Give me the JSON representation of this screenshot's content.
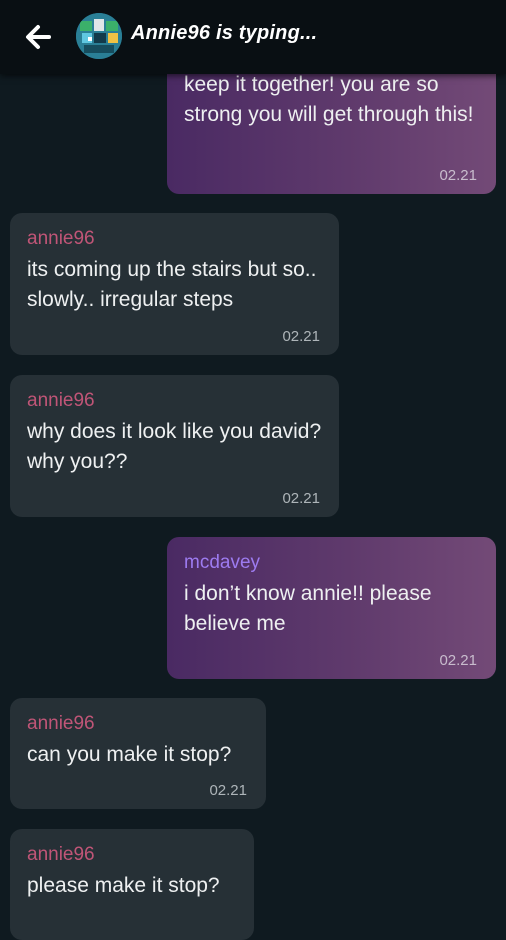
{
  "header": {
    "title": "Annie96 is typing..."
  },
  "messages": [
    {
      "sender": "",
      "text": "keep it together! you are so strong you will get through this!",
      "time": "02.21",
      "direction": "out"
    },
    {
      "sender": "annie96",
      "text": "its coming up the stairs but so.. slowly.. irregular steps",
      "time": "02.21",
      "direction": "in"
    },
    {
      "sender": "annie96",
      "text": "why does it look like you david? why you??",
      "time": "02.21",
      "direction": "in"
    },
    {
      "sender": "mcdavey",
      "text": "i don’t know annie!! please believe me",
      "time": "02.21",
      "direction": "out"
    },
    {
      "sender": "annie96",
      "text": "can you make it stop?",
      "time": "02.21",
      "direction": "in"
    },
    {
      "sender": "annie96",
      "text": "please make it stop?",
      "time": "",
      "direction": "in"
    }
  ],
  "colors": {
    "background": "#0f1a20",
    "incoming_bubble": "#263036",
    "outgoing_bubble": "#5f3a6c",
    "incoming_sender": "#c05577",
    "outgoing_sender": "#9d7bf0"
  }
}
